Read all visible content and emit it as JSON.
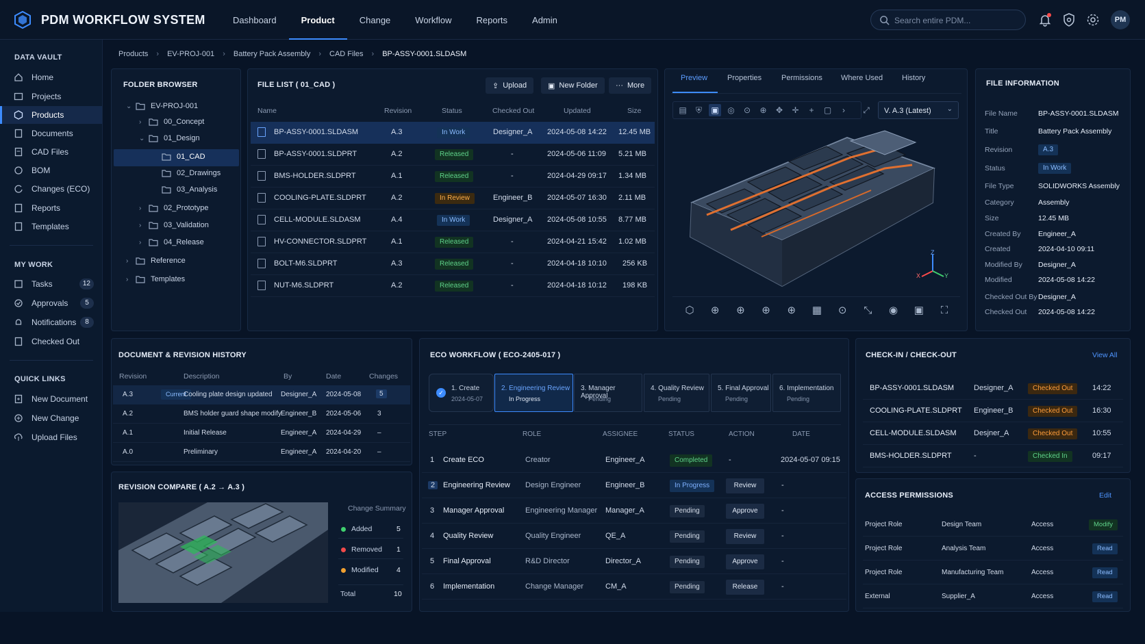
{
  "app": {
    "title": "PDM WORKFLOW SYSTEM",
    "avatar": "PM"
  },
  "nav": [
    "Dashboard",
    "Product",
    "Change",
    "Workflow",
    "Reports",
    "Admin"
  ],
  "search": {
    "placeholder": "Search entire PDM..."
  },
  "sidebar": {
    "data_vault": {
      "heading": "DATA VAULT",
      "items": [
        "Home",
        "Projects",
        "Products",
        "Documents",
        "CAD Files",
        "BOM",
        "Changes (ECO)",
        "Reports",
        "Templates"
      ]
    },
    "my_work": {
      "heading": "MY WORK",
      "items": [
        {
          "label": "Tasks",
          "count": "12"
        },
        {
          "label": "Approvals",
          "count": "5"
        },
        {
          "label": "Notifications",
          "count": "8"
        },
        {
          "label": "Checked Out",
          "count": ""
        }
      ]
    },
    "quick_links": {
      "heading": "QUICK LINKS",
      "items": [
        "New Document",
        "New Change",
        "Upload Files"
      ]
    }
  },
  "breadcrumb": [
    "Products",
    "EV-PROJ-001",
    "Battery Pack Assembly",
    "CAD Files",
    "BP-ASSY-0001.SLDASM"
  ],
  "folder_browser": {
    "title": "FOLDER BROWSER",
    "items": [
      "EV-PROJ-001",
      "00_Concept",
      "01_Design",
      "01_CAD",
      "02_Drawings",
      "03_Analysis",
      "02_Prototype",
      "03_Validation",
      "04_Release",
      "Reference",
      "Templates"
    ]
  },
  "file_list": {
    "title": "FILE LIST ( 01_CAD )",
    "buttons": {
      "upload": "Upload",
      "new_folder": "New Folder",
      "more": "More"
    },
    "columns": [
      "Name",
      "Revision",
      "Status",
      "Checked Out",
      "Updated",
      "Size"
    ],
    "rows": [
      {
        "name": "BP-ASSY-0001.SLDASM",
        "rev": "A.3",
        "status": "In Work",
        "out": "Designer_A",
        "updated": "2024-05-08 14:22",
        "size": "12.45 MB"
      },
      {
        "name": "BP-ASSY-0001.SLDPRT",
        "rev": "A.2",
        "status": "Released",
        "out": "-",
        "updated": "2024-05-06 11:09",
        "size": "5.21 MB"
      },
      {
        "name": "BMS-HOLDER.SLDPRT",
        "rev": "A.1",
        "status": "Released",
        "out": "-",
        "updated": "2024-04-29 09:17",
        "size": "1.34 MB"
      },
      {
        "name": "COOLING-PLATE.SLDPRT",
        "rev": "A.2",
        "status": "In Review",
        "out": "Engineer_B",
        "updated": "2024-05-07 16:30",
        "size": "2.11 MB"
      },
      {
        "name": "CELL-MODULE.SLDASM",
        "rev": "A.4",
        "status": "In Work",
        "out": "Designer_A",
        "updated": "2024-05-08 10:55",
        "size": "8.77 MB"
      },
      {
        "name": "HV-CONNECTOR.SLDPRT",
        "rev": "A.1",
        "status": "Released",
        "out": "-",
        "updated": "2024-04-21 15:42",
        "size": "1.02 MB"
      },
      {
        "name": "BOLT-M6.SLDPRT",
        "rev": "A.3",
        "status": "Released",
        "out": "-",
        "updated": "2024-04-18 10:10",
        "size": "256 KB"
      },
      {
        "name": "NUT-M6.SLDPRT",
        "rev": "A.2",
        "status": "Released",
        "out": "-",
        "updated": "2024-04-18 10:12",
        "size": "198 KB"
      }
    ]
  },
  "viewer": {
    "tabs": [
      "Preview",
      "Properties",
      "Permissions",
      "Where Used",
      "History"
    ],
    "version": "V. A.3 (Latest)",
    "axes": {
      "x": "X",
      "y": "Y",
      "z": "Z"
    }
  },
  "file_info": {
    "title": "FILE INFORMATION",
    "fields": [
      {
        "k": "File Name",
        "v": "BP-ASSY-0001.SLDASM"
      },
      {
        "k": "Title",
        "v": "Battery Pack Assembly"
      },
      {
        "k": "Revision",
        "v": "A.3"
      },
      {
        "k": "Status",
        "v": "In Work"
      },
      {
        "k": "File Type",
        "v": "SOLIDWORKS Assembly"
      },
      {
        "k": "Category",
        "v": "Assembly"
      },
      {
        "k": "Size",
        "v": "12.45 MB"
      },
      {
        "k": "Created By",
        "v": "Engineer_A"
      },
      {
        "k": "Created",
        "v": "2024-04-10 09:11"
      },
      {
        "k": "Modified By",
        "v": "Designer_A"
      },
      {
        "k": "Modified",
        "v": "2024-05-08 14:22"
      },
      {
        "k": "Checked Out By",
        "v": "Designer_A"
      },
      {
        "k": "Checked Out",
        "v": "2024-05-08 14:22"
      }
    ]
  },
  "doc_history": {
    "title": "DOCUMENT & REVISION HISTORY",
    "columns": [
      "Revision",
      "Description",
      "By",
      "Date",
      "Changes"
    ],
    "current_label": "Current",
    "rows": [
      {
        "rev": "A.3",
        "desc": "Cooling plate design updated",
        "by": "Designer_A",
        "date": "2024-05-08",
        "changes": "5"
      },
      {
        "rev": "A.2",
        "desc": "BMS holder guard shape modify",
        "by": "Engineer_B",
        "date": "2024-05-06",
        "changes": "3"
      },
      {
        "rev": "A.1",
        "desc": "Initial Release",
        "by": "Engineer_A",
        "date": "2024-04-29",
        "changes": "–"
      },
      {
        "rev": "A.0",
        "desc": "Preliminary",
        "by": "Engineer_A",
        "date": "2024-04-20",
        "changes": "–"
      }
    ]
  },
  "revision_compare": {
    "title": "REVISION COMPARE ( A.2 → A.3 )",
    "summary_title": "Change Summary",
    "items": [
      {
        "label": "Added",
        "count": "5",
        "color": "#3fcf6e"
      },
      {
        "label": "Removed",
        "count": "1",
        "color": "#f04a4a"
      },
      {
        "label": "Modified",
        "count": "4",
        "color": "#f0a030"
      }
    ],
    "total_label": "Total",
    "total": "10"
  },
  "eco": {
    "title": "ECO WORKFLOW ( ECO-2405-017 )",
    "steps_bar": [
      {
        "t": "1. Create",
        "s": "2024-05-07"
      },
      {
        "t": "2. Engineering Review",
        "s": "In Progress"
      },
      {
        "t": "3. Manager Approval",
        "s": "Pending"
      },
      {
        "t": "4. Quality Review",
        "s": "Pending"
      },
      {
        "t": "5. Final Approval",
        "s": "Pending"
      },
      {
        "t": "6. Implementation",
        "s": "Pending"
      }
    ],
    "columns": [
      "STEP",
      "ROLE",
      "ASSIGNEE",
      "STATUS",
      "ACTION",
      "DATE"
    ],
    "rows": [
      {
        "n": "1",
        "step": "Create ECO",
        "role": "Creator",
        "who": "Engineer_A",
        "status": "Completed",
        "action": "-",
        "date": "2024-05-07 09:15"
      },
      {
        "n": "2",
        "step": "Engineering Review",
        "role": "Design Engineer",
        "who": "Engineer_B",
        "status": "In Progress",
        "action": "Review",
        "date": "-"
      },
      {
        "n": "3",
        "step": "Manager Approval",
        "role": "Engineering Manager",
        "who": "Manager_A",
        "status": "Pending",
        "action": "Approve",
        "date": "-"
      },
      {
        "n": "4",
        "step": "Quality Review",
        "role": "Quality Engineer",
        "who": "QE_A",
        "status": "Pending",
        "action": "Review",
        "date": "-"
      },
      {
        "n": "5",
        "step": "Final Approval",
        "role": "R&D Director",
        "who": "Director_A",
        "status": "Pending",
        "action": "Approve",
        "date": "-"
      },
      {
        "n": "6",
        "step": "Implementation",
        "role": "Change Manager",
        "who": "CM_A",
        "status": "Pending",
        "action": "Release",
        "date": "-"
      }
    ]
  },
  "checkinout": {
    "title": "CHECK-IN / CHECK-OUT",
    "view_all": "View All",
    "rows": [
      {
        "file": "BP-ASSY-0001.SLDASM",
        "who": "Designer_A",
        "status": "Checked Out",
        "time": "14:22"
      },
      {
        "file": "COOLING-PLATE.SLDPRT",
        "who": "Engineer_B",
        "status": "Checked Out",
        "time": "16:30"
      },
      {
        "file": "CELL-MODULE.SLDASM",
        "who": "Desjner_A",
        "status": "Checked Out",
        "time": "10:55"
      },
      {
        "file": "BMS-HOLDER.SLDPRT",
        "who": "-",
        "status": "Checked In",
        "time": "09:17"
      }
    ]
  },
  "access": {
    "title": "ACCESS PERMISSIONS",
    "edit": "Edit",
    "rows": [
      {
        "type": "Project Role",
        "who": "Design Team",
        "label": "Access",
        "perm": "Modify"
      },
      {
        "type": "Project Role",
        "who": "Analysis Team",
        "label": "Access",
        "perm": "Read"
      },
      {
        "type": "Project Role",
        "who": "Manufacturing Team",
        "label": "Access",
        "perm": "Read"
      },
      {
        "type": "External",
        "who": "Supplier_A",
        "label": "Access",
        "perm": "Read"
      }
    ]
  },
  "colors": {
    "accent": "#3d8cff",
    "bg": "#081426",
    "panel": "#0c1a2e",
    "added": "#3fcf6e",
    "removed": "#f04a4a",
    "modified": "#f0a030"
  }
}
